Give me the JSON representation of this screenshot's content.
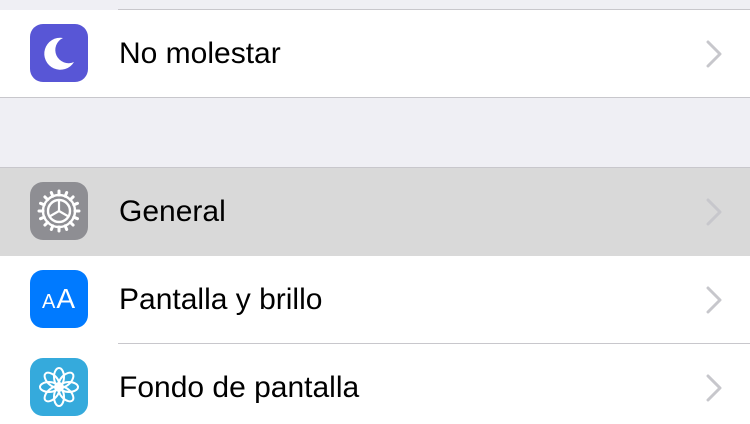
{
  "colors": {
    "group_background": "#efeff4",
    "row_background": "#ffffff",
    "row_selected_background": "#d9d9d9",
    "separator": "#c8c7cc",
    "chevron": "#c7c7cc",
    "icon_no_molestar": "#5856d6",
    "icon_general": "#8e8e93",
    "icon_pantalla": "#007aff",
    "icon_fondo": "#35aadc"
  },
  "settings": {
    "group1": [
      {
        "label": "No molestar",
        "icon": "moon-icon"
      }
    ],
    "group2": [
      {
        "label": "General",
        "icon": "gear-icon",
        "selected": true
      },
      {
        "label": "Pantalla y brillo",
        "icon": "text-size-icon",
        "icon_text_small": "A",
        "icon_text_large": "A"
      },
      {
        "label": "Fondo de pantalla",
        "icon": "flower-icon"
      }
    ]
  }
}
